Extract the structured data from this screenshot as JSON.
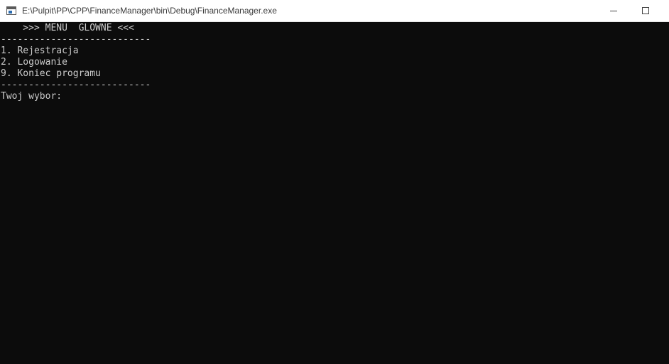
{
  "window": {
    "title": "E:\\Pulpit\\PP\\CPP\\FinanceManager\\bin\\Debug\\FinanceManager.exe",
    "app_icon": "console-app-icon",
    "minimize_icon": "minimize-icon",
    "maximize_icon": "maximize-icon"
  },
  "console": {
    "header": "    >>> MENU  GLOWNE <<<",
    "separator_top": "---------------------------",
    "options": [
      "1. Rejestracja",
      "2. Logowanie",
      "9. Koniec programu"
    ],
    "separator_bottom": "---------------------------",
    "prompt": "Twoj wybor:"
  },
  "colors": {
    "console_background": "#0c0c0c",
    "console_text": "#cccccc",
    "titlebar_background": "#ffffff"
  }
}
